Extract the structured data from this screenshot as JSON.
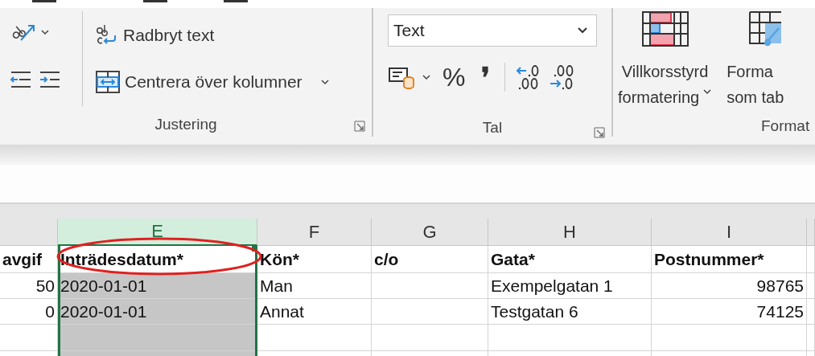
{
  "ribbon": {
    "alignment_group": {
      "label": "Justering",
      "wrap_text": "Radbryt text",
      "merge": "Centrera över kolumner"
    },
    "number_group": {
      "label": "Tal",
      "format": "Text",
      "percent": "%",
      "comma": "❜"
    },
    "styles_group": {
      "label": "Format",
      "conditional": [
        "Villkorsstyrd",
        "formatering"
      ],
      "format_table": [
        "Forma",
        "som tab"
      ]
    }
  },
  "sheet": {
    "columns": [
      {
        "numeric": true,
        "selected": false
      },
      {
        "letter": "E",
        "numeric": false,
        "selected": true
      },
      {
        "letter": "F",
        "numeric": false,
        "selected": false
      },
      {
        "letter": "G",
        "numeric": false,
        "selected": false
      },
      {
        "letter": "H",
        "numeric": false,
        "selected": false
      },
      {
        "letter": "I",
        "numeric": true,
        "selected": false
      },
      {
        "numeric": false,
        "selected": false
      }
    ],
    "rows": [
      {
        "kind": "header",
        "cells": [
          "avgif",
          "Inträdesdatum*",
          "Kön*",
          "c/o",
          "Gata*",
          "Postnummer*",
          ""
        ]
      },
      {
        "kind": "data",
        "cells": [
          "50",
          "2020-01-01",
          "Man",
          "",
          "Exempelgatan 1",
          "98765",
          ""
        ]
      },
      {
        "kind": "data",
        "cells": [
          "0",
          "2020-01-01",
          "Annat",
          "",
          "Testgatan 6",
          "74125",
          ""
        ]
      }
    ]
  }
}
